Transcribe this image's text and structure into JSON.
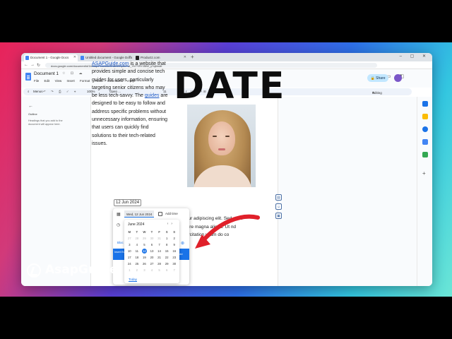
{
  "browser": {
    "tabs": [
      {
        "label": "Document 1 - Google Docs",
        "color": "#4285f4",
        "active": true
      },
      {
        "label": "Untitled document - Google Docs",
        "color": "#4285f4",
        "active": false
      },
      {
        "label": "Productz.com",
        "color": "#222222",
        "active": false
      }
    ],
    "new_tab": "+",
    "window_controls": "– ▢ ✕",
    "url": "docs.google.com/document/d/1bNdqnPLauWkfRhB0ORyZu7wl_YhTYRYJ5lW_y7q8/edit"
  },
  "doc": {
    "title": "Document 1",
    "menus": [
      "File",
      "Edit",
      "View",
      "Insert",
      "Format",
      "Tools",
      "Extensions",
      "Help"
    ],
    "share_label": "Share",
    "editing_label": "Editing"
  },
  "toolbar": {
    "search_label": "Menus",
    "zoom": "100%",
    "style": "Open ...",
    "font": "",
    "size": "11",
    "bold": "B",
    "italic": "I",
    "underline": "U"
  },
  "outline": {
    "back_icon": "←",
    "title": "Outline",
    "hint": "Headings that you add to the document will appear here."
  },
  "content": {
    "link1": "ASAPGuide.com",
    "p1": " is a website that provides simple and concise tech guides for users, particularly targeting senior citizens who may be less tech-savvy. The ",
    "link2": "guides",
    "p2": " are designed to  be easy to follow and address specific problems without  unnecessary information, ensuring that users can quickly find solutions to their tech-related issues.",
    "date_chip": "12 Jun 2024",
    "lorem": "ctetur adipiscing elit. Sed re et dolore magna aliqua. Ut nd exercitation ullam do co"
  },
  "overlay": {
    "headline": "DATE",
    "brand": "AsapGuide"
  },
  "date_popup": {
    "date_field": "Wed, 12 Jun 2024",
    "time_label": "Add time",
    "left_link": "Bloc",
    "blue_left_label": "Insert Event",
    "blue_right_label": "dd",
    "calendar": {
      "month": "June 2024",
      "weekdays": [
        "M",
        "T",
        "W",
        "T",
        "F",
        "S",
        "S"
      ],
      "days": [
        [
          "27",
          "28",
          "29",
          "30",
          "31",
          "1",
          "2"
        ],
        [
          "3",
          "4",
          "5",
          "6",
          "7",
          "8",
          "9"
        ],
        [
          "10",
          "11",
          "12",
          "13",
          "14",
          "15",
          "16"
        ],
        [
          "17",
          "18",
          "19",
          "20",
          "21",
          "22",
          "23"
        ],
        [
          "24",
          "25",
          "26",
          "27",
          "28",
          "29",
          "30"
        ],
        [
          "1",
          "2",
          "3",
          "4",
          "5",
          "6",
          "7"
        ]
      ],
      "selected": "12",
      "today_label": "Today"
    }
  },
  "colors": {
    "accent": "#1a73e8",
    "arrow": "#e0202a"
  }
}
